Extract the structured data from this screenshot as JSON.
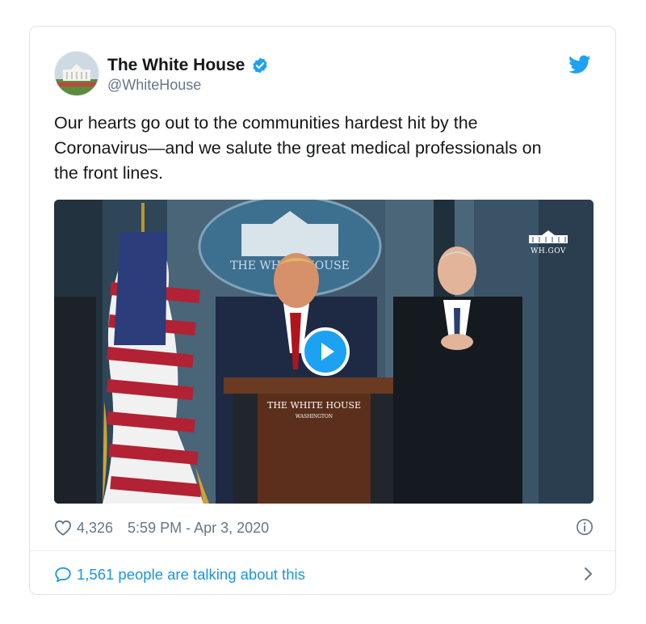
{
  "author": {
    "display_name": "The White House",
    "handle": "@WhiteHouse"
  },
  "tweet": {
    "text": "Our hearts go out to the communities hardest hit by the\nCoronavirus—and we salute the great medical professionals on\nthe front lines."
  },
  "media": {
    "seal_text": "THE WHITE HOUSE",
    "watermark": "WH.GOV",
    "podium_title": "THE WHITE HOUSE",
    "podium_subtitle": "WASHINGTON"
  },
  "meta": {
    "likes": "4,326",
    "timestamp": "5:59 PM - Apr 3, 2020"
  },
  "footer": {
    "talking": "1,561 people are talking about this"
  },
  "colors": {
    "accent": "#1da1f2",
    "link": "#1b95e0",
    "muted": "#657786"
  },
  "icons": [
    "verified-badge-icon",
    "twitter-bird-icon",
    "play-icon",
    "heart-icon",
    "info-icon",
    "chat-bubble-icon",
    "chevron-right-icon"
  ]
}
